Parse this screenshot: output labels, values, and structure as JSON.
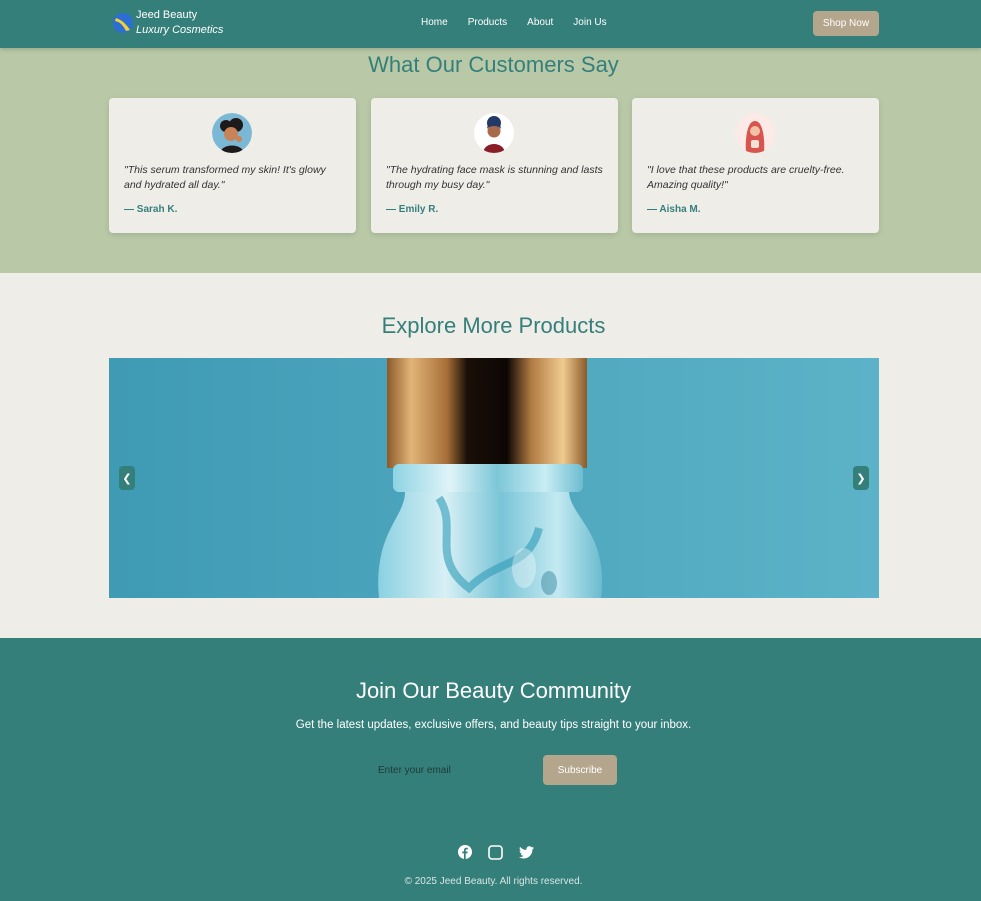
{
  "header": {
    "brand_name": "Jeed Beauty",
    "brand_tagline": "Luxury Cosmetics",
    "nav": [
      "Home",
      "Products",
      "About",
      "Join Us"
    ],
    "cta": "Shop Now"
  },
  "testimonials": {
    "title": "What Our Customers Say",
    "items": [
      {
        "quote": "\"This serum transformed my skin! It's glowy and hydrated all day.\"",
        "author": "— Sarah K."
      },
      {
        "quote": "\"The hydrating face mask is stunning and lasts through my busy day.\"",
        "author": "— Emily R."
      },
      {
        "quote": "\"I love that these products are cruelty-free. Amazing quality!\"",
        "author": "— Aisha M."
      }
    ]
  },
  "explore": {
    "title": "Explore More Products",
    "prev_label": "❮",
    "next_label": "❯"
  },
  "community": {
    "title": "Join Our Beauty Community",
    "subtitle": "Get the latest updates, exclusive offers, and beauty tips straight to your inbox.",
    "email_placeholder": "Enter your email",
    "subscribe_label": "Subscribe",
    "socials": [
      "facebook-icon",
      "instagram-icon",
      "twitter-icon"
    ],
    "copyright": "© 2025 Jeed Beauty. All rights reserved."
  },
  "colors": {
    "teal": "#357f7b",
    "sage": "#b9c9a7",
    "sand": "#b4a68c",
    "cream": "#efede8"
  }
}
